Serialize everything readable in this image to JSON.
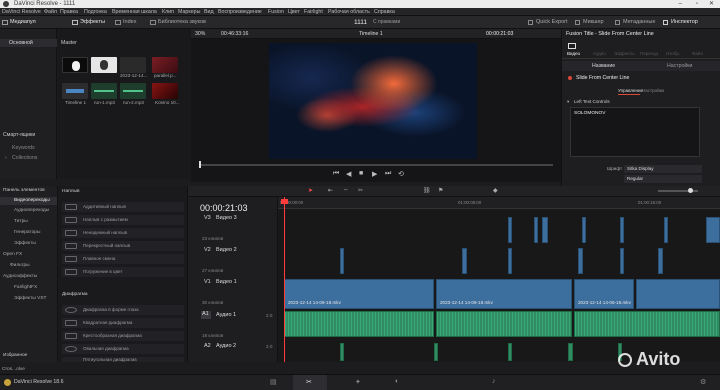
{
  "window": {
    "title": "DaVinci Resolve - 1111"
  },
  "menu": [
    "DaVinci Resolve",
    "Файл",
    "Правка",
    "Подгонка",
    "Временная шкала",
    "Клип",
    "Маркеры",
    "Вид",
    "Воспроизведение",
    "Fusion",
    "Цвет",
    "Fairlight",
    "Рабочая область",
    "Справка"
  ],
  "toolbar": {
    "media_pool": "Медиапул",
    "effects": "Эффекты",
    "index": "Index",
    "sound_library": "Библиотека звуков",
    "project_name": "1111",
    "project_status": "С правками",
    "quick_export": "Quick Export",
    "mixer": "Микшер",
    "metadata": "Метаданные",
    "inspector": "Инспектор"
  },
  "left_panel": {
    "tab": "Основной",
    "smart_bins": "Смарт-ящики",
    "keywords": "Keywords",
    "collections": "Collections"
  },
  "media_pool": {
    "header": "Master",
    "items": [
      {
        "label": "",
        "color": "#0a0a0a"
      },
      {
        "label": "",
        "color": "#dcdcdc"
      },
      {
        "label": "2023-12-14...",
        "color": "#2a2a2a"
      },
      {
        "label": "parallel.p...",
        "color": "#6a1e22"
      },
      {
        "label": "Timeline 1",
        "color": "#2d2d30"
      },
      {
        "label": "run-1.mp3",
        "color": "#1f3d2c"
      },
      {
        "label": "run-2.mp3",
        "color": "#1f3d2c"
      },
      {
        "label": "Kosmo 10...",
        "color": "#5a1010"
      }
    ]
  },
  "viewer": {
    "zoom": "30%",
    "timecode_left": "00:46:33:16",
    "timeline_name": "Timeline 1",
    "timecode_right": "00:00:21:03"
  },
  "inspector": {
    "title": "Fusion Title - Slide From Center Line",
    "tabs": [
      "Видео",
      "Аудио",
      "Эффекты",
      "Переход",
      "Изобр.",
      "Файл"
    ],
    "sub_tabs": [
      "Название",
      "Настройки"
    ],
    "effect_name": "Slide From Center Line",
    "sub_tabs2": [
      "Управление",
      "Настройки"
    ],
    "section": "Left Text Controls",
    "text_value": "SOLOMONOV",
    "font_label": "Шрифт",
    "font_value": "Sitka Display",
    "style_value": "Regular"
  },
  "effects_panel": {
    "categories": [
      "Панель элементов",
      "Видеопереходы",
      "Аудиопереходы",
      "Титры",
      "Генераторы",
      "Эффекты",
      "Open FX",
      "Фильтры",
      "Аудиоэффекты",
      "FairlightFX",
      "Эффекты VST"
    ],
    "favorites": "Избранное",
    "favorite_item": "Cros...olve",
    "section1": "Наплыв",
    "items1": [
      "Аддитивный наплыв",
      "Наплыв с размытием",
      "Ненадежный наплыв",
      "Перекрестный наплыв",
      "Плавное смена",
      "Погружение в цвет"
    ],
    "section2": "Диафрагма",
    "items2": [
      "Диафрагма в форме глаза",
      "Квадратная диафрагма",
      "Крестообразная диафрагма",
      "Овальная диафрагма",
      "Пятиугольная диафрагма"
    ]
  },
  "timeline": {
    "timecode": "00:00:21:03",
    "ruler": [
      "01:00:00:00",
      "01:00:08:00",
      "01:00:16:00"
    ],
    "tracks": [
      {
        "id": "V3",
        "name": "Видео 3",
        "clips": "23 клипов"
      },
      {
        "id": "V2",
        "name": "Видео 2",
        "clips": "27 клипов"
      },
      {
        "id": "V1",
        "name": "Видео 1",
        "clips": "30 клипов"
      },
      {
        "id": "A1",
        "name": "Аудио 1",
        "level": "2.0",
        "clips": "18 клипов"
      },
      {
        "id": "A2",
        "name": "Аудио 2",
        "level": "2.0"
      }
    ],
    "clip_name": "2023-12-14 14-06-18.mkv"
  },
  "statusbar": {
    "app": "DaVinci Resolve 18.6"
  },
  "watermark": "Avito"
}
